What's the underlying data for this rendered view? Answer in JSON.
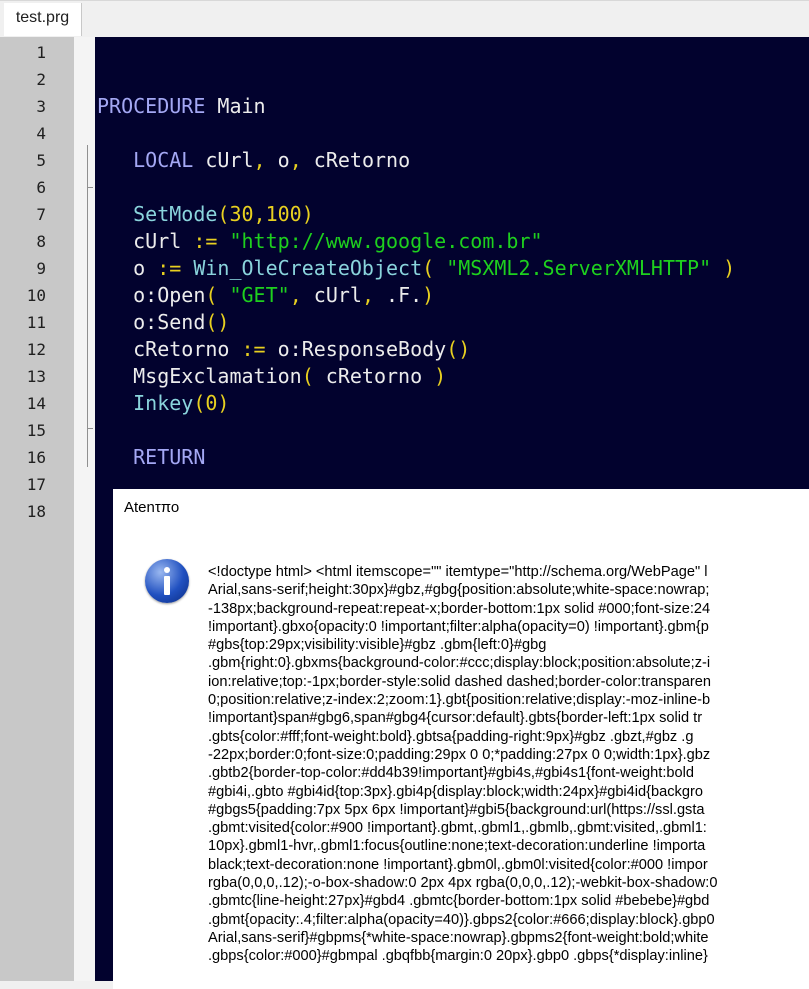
{
  "tab": {
    "label": "test.prg"
  },
  "line_numbers": [
    "1",
    "2",
    "3",
    "4",
    "5",
    "6",
    "7",
    "8",
    "9",
    "10",
    "11",
    "12",
    "13",
    "14",
    "15",
    "16",
    "17",
    "18"
  ],
  "syntax_colors": {
    "keyword": "#a4a8f4",
    "function": "#8ad4dc",
    "identifier": "#ececec",
    "string": "#1ed01e",
    "operator": "#e8d020",
    "background": "#02022e"
  },
  "code": [
    {
      "line": 3,
      "tokens": [
        {
          "t": "PROCEDURE",
          "c": "kw"
        },
        {
          "t": " Main",
          "c": "id"
        }
      ]
    },
    {
      "line": 5,
      "tokens": [
        {
          "t": "   LOCAL",
          "c": "kw"
        },
        {
          "t": " cUrl",
          "c": "id"
        },
        {
          "t": ",",
          "c": "op"
        },
        {
          "t": " o",
          "c": "id"
        },
        {
          "t": ",",
          "c": "op"
        },
        {
          "t": " cRetorno",
          "c": "id"
        }
      ]
    },
    {
      "line": 7,
      "tokens": [
        {
          "t": "   SetMode",
          "c": "fn"
        },
        {
          "t": "(30,100)",
          "c": "op"
        }
      ]
    },
    {
      "line": 8,
      "tokens": [
        {
          "t": "   cUrl",
          "c": "id"
        },
        {
          "t": " := ",
          "c": "op"
        },
        {
          "t": "\"http://www.google.com.br\"",
          "c": "st"
        }
      ]
    },
    {
      "line": 9,
      "tokens": [
        {
          "t": "   o",
          "c": "id"
        },
        {
          "t": " := ",
          "c": "op"
        },
        {
          "t": "Win_OleCreateObject",
          "c": "fn"
        },
        {
          "t": "( ",
          "c": "op"
        },
        {
          "t": "\"MSXML2.ServerXMLHTTP\"",
          "c": "st"
        },
        {
          "t": " )",
          "c": "op"
        }
      ]
    },
    {
      "line": 10,
      "tokens": [
        {
          "t": "   o:Open",
          "c": "id"
        },
        {
          "t": "( ",
          "c": "op"
        },
        {
          "t": "\"GET\"",
          "c": "st"
        },
        {
          "t": ", ",
          "c": "op"
        },
        {
          "t": "cUrl",
          "c": "id"
        },
        {
          "t": ", ",
          "c": "op"
        },
        {
          "t": ".F.",
          "c": "id"
        },
        {
          "t": ")",
          "c": "op"
        }
      ]
    },
    {
      "line": 11,
      "tokens": [
        {
          "t": "   o:Send",
          "c": "id"
        },
        {
          "t": "()",
          "c": "op"
        }
      ]
    },
    {
      "line": 12,
      "tokens": [
        {
          "t": "   cRetorno",
          "c": "id"
        },
        {
          "t": " := ",
          "c": "op"
        },
        {
          "t": "o:ResponseBody",
          "c": "id"
        },
        {
          "t": "()",
          "c": "op"
        }
      ]
    },
    {
      "line": 13,
      "tokens": [
        {
          "t": "   MsgExclamation",
          "c": "id"
        },
        {
          "t": "( ",
          "c": "op"
        },
        {
          "t": "cRetorno",
          "c": "id"
        },
        {
          "t": " )",
          "c": "op"
        }
      ]
    },
    {
      "line": 14,
      "tokens": [
        {
          "t": "   Inkey",
          "c": "fn"
        },
        {
          "t": "(0)",
          "c": "op"
        }
      ]
    },
    {
      "line": 16,
      "tokens": [
        {
          "t": "   RETURN",
          "c": "kw"
        }
      ]
    }
  ],
  "dialog": {
    "title": "Atenτπο",
    "icon": "info-icon",
    "message_lines": [
      "<!doctype html> <html itemscope=\"\" itemtype=\"http://schema.org/WebPage\" l",
      "Arial,sans-serif;height:30px}#gbz,#gbg{position:absolute;white-space:nowrap;",
      "-138px;background-repeat:repeat-x;border-bottom:1px solid #000;font-size:24",
      "!important}.gbxo{opacity:0 !important;filter:alpha(opacity=0) !important}.gbm{p",
      "#gbs{top:29px;visibility:visible}#gbz .gbm{left:0}#gbg",
      ".gbm{right:0}.gbxms{background-color:#ccc;display:block;position:absolute;z-i",
      "ion:relative;top:-1px;border-style:solid dashed dashed;border-color:transparen",
      "0;position:relative;z-index:2;zoom:1}.gbt{position:relative;display:-moz-inline-b",
      "!important}span#gbg6,span#gbg4{cursor:default}.gbts{border-left:1px solid tr",
      ".gbts{color:#fff;font-weight:bold}.gbtsa{padding-right:9px}#gbz .gbzt,#gbz .g",
      "-22px;border:0;font-size:0;padding:29px 0 0;*padding:27px 0 0;width:1px}.gbz",
      ".gbtb2{border-top-color:#dd4b39!important}#gbi4s,#gbi4s1{font-weight:bold",
      "#gbi4i,.gbto #gbi4id{top:3px}.gbi4p{display:block;width:24px}#gbi4id{backgro",
      "#gbgs5{padding:7px 5px 6px !important}#gbi5{background:url(https://ssl.gsta",
      ".gbmt:visited{color:#900 !important}.gbmt,.gbml1,.gbmlb,.gbmt:visited,.gbml1:",
      "10px}.gbml1-hvr,.gbml1:focus{outline:none;text-decoration:underline !importa",
      "black;text-decoration:none !important}.gbm0l,.gbm0l:visited{color:#000 !impor",
      "rgba(0,0,0,.12);-o-box-shadow:0 2px 4px rgba(0,0,0,.12);-webkit-box-shadow:0",
      ".gbmtc{line-height:27px}#gbd4 .gbmtc{border-bottom:1px solid #bebebe}#gbd",
      ".gbmt{opacity:.4;filter:alpha(opacity=40)}.gbps2{color:#666;display:block}.gbp0",
      "Arial,sans-serif}#gbpms{*white-space:nowrap}.gbpms2{font-weight:bold;white",
      ".gbps{color:#000}#gbmpal .gbqfbb{margin:0 20px}.gbp0 .gbps{*display:inline}"
    ]
  }
}
